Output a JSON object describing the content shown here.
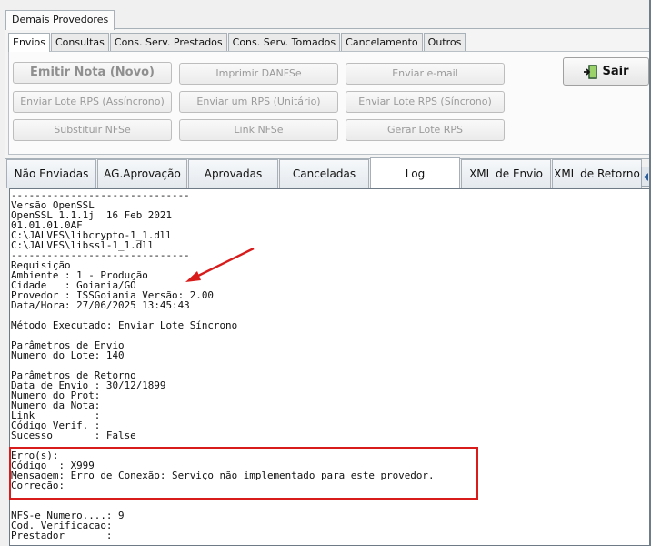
{
  "window": {
    "outer_tab": "Demais Provedores",
    "inner_tabs": [
      {
        "label": "Envios",
        "active": true
      },
      {
        "label": "Consultas",
        "active": false
      },
      {
        "label": "Cons. Serv. Prestados",
        "active": false
      },
      {
        "label": "Cons. Serv. Tomados",
        "active": false
      },
      {
        "label": "Cancelamento",
        "active": false
      },
      {
        "label": "Outros",
        "active": false
      }
    ]
  },
  "buttons": {
    "emitir_nota": "Emitir Nota (Novo)",
    "imprimir_danfse": "Imprimir DANFSe",
    "enviar_email": "Enviar e-mail",
    "enviar_lote_assincrono": "Enviar Lote RPS (Assíncrono)",
    "enviar_um_rps": "Enviar um RPS (Unitário)",
    "enviar_lote_sincrono": "Enviar Lote RPS (Síncrono)",
    "substituir_nfse": "Substituir NFSe",
    "link_nfse": "Link NFSe",
    "gerar_lote": "Gerar Lote RPS",
    "sair_mnemonic": "S",
    "sair_rest": "air"
  },
  "log_tabs": [
    {
      "label": "Não Enviadas",
      "active": false
    },
    {
      "label": "AG.Aprovação",
      "active": false
    },
    {
      "label": "Aprovadas",
      "active": false
    },
    {
      "label": "Canceladas",
      "active": false
    },
    {
      "label": "Log",
      "active": true
    },
    {
      "label": "XML de Envio",
      "active": false
    },
    {
      "label": "XML de Retorno",
      "active": false
    }
  ],
  "log": {
    "text": "------------------------------\nVersão OpenSSL\nOpenSSL 1.1.1j  16 Feb 2021\n01.01.01.0AF\nC:\\JALVES\\libcrypto-1_1.dll\nC:\\JALVES\\libssl-1_1.dll\n------------------------------\nRequisição\nAmbiente : 1 - Produção\nCidade   : Goiania/GO\nProvedor : ISSGoiania Versão: 2.00\nData/Hora: 27/06/2025 13:45:43\n\nMétodo Executado: Enviar Lote Síncrono\n\nParâmetros de Envio\nNumero do Lote: 140\n\nParâmetros de Retorno\nData de Envio : 30/12/1899\nNumero do Prot:\nNumero da Nota:\nLink          :\nCódigo Verif. :\nSucesso       : False\n\nErro(s):\nCódigo  : X999\nMensagem: Erro de Conexão: Serviço não implementado para este provedor.\nCorreção:\n\n\nNFS-e Numero....: 9\nCod. Verificacao:\nPrestador       :"
  },
  "colors": {
    "highlight": "#d81c1c",
    "arrow": "#d81c1c"
  }
}
